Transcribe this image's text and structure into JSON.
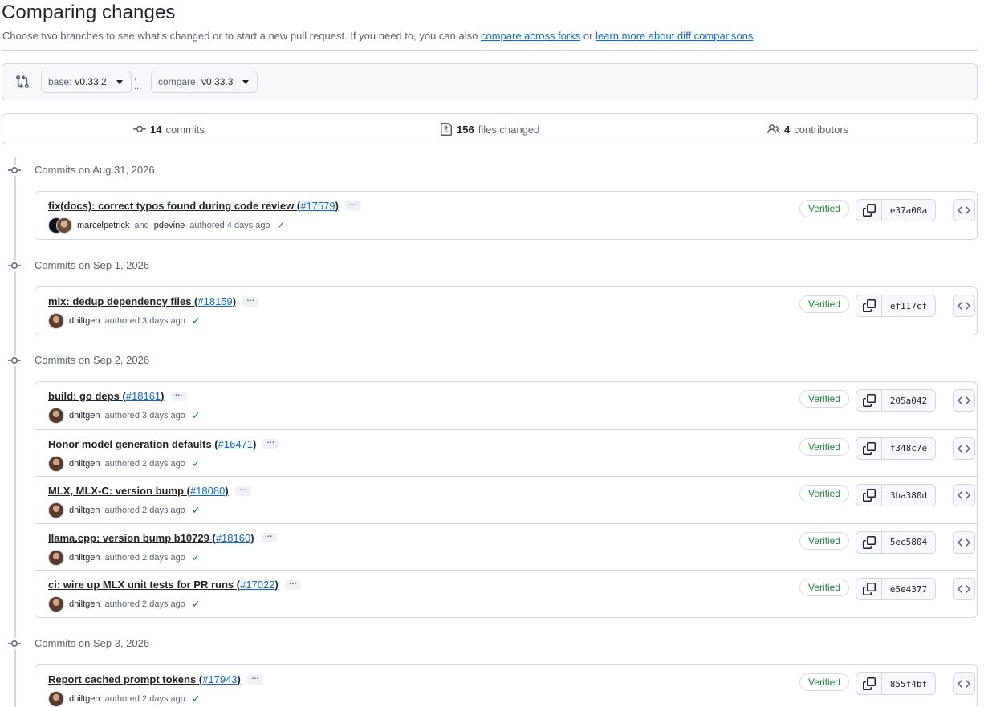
{
  "header": {
    "title": "Comparing changes",
    "subtitle_text": "Choose two branches to see what’s changed or to start a new pull request. If you need to, you can also",
    "link_forks": "compare across forks",
    "or_text": "or",
    "link_learn": "learn more about diff comparisons",
    "period": "."
  },
  "range": {
    "base_label": "base:",
    "base_value": "v0.33.2",
    "compare_label": "compare:",
    "compare_value": "v0.33.3",
    "arrow_dots": "..."
  },
  "summary": {
    "commits_count": "14",
    "commits_label": "commits",
    "files_count": "156",
    "files_label": "files changed",
    "contributors_count": "4",
    "contributors_label": "contributors"
  },
  "groups": [
    {
      "label": "Commits on Aug 31, 2026",
      "commits": [
        {
          "title": "fix(docs): correct typos found during code review",
          "pr": "#17579",
          "authors": [
            "marcelpetrick",
            "pdevine"
          ],
          "and_text": "and",
          "authored": "authored 4 days ago",
          "verified": "Verified",
          "sha": "e37a00a"
        }
      ]
    },
    {
      "label": "Commits on Sep 1, 2026",
      "commits": [
        {
          "title": "mlx: dedup dependency files",
          "pr": "#18159",
          "authors": [
            "dhiltgen"
          ],
          "authored": "authored 3 days ago",
          "verified": "Verified",
          "sha": "ef117cf"
        }
      ]
    },
    {
      "label": "Commits on Sep 2, 2026",
      "commits": [
        {
          "title": "build: go deps",
          "pr": "#18161",
          "authors": [
            "dhiltgen"
          ],
          "authored": "authored 3 days ago",
          "verified": "Verified",
          "sha": "205a042"
        },
        {
          "title": "Honor model generation defaults",
          "pr": "#16471",
          "authors": [
            "dhiltgen"
          ],
          "authored": "authored 2 days ago",
          "verified": "Verified",
          "sha": "f348c7e"
        },
        {
          "title": "MLX, MLX-C: version bump",
          "pr": "#18080",
          "authors": [
            "dhiltgen"
          ],
          "authored": "authored 2 days ago",
          "verified": "Verified",
          "sha": "3ba380d"
        },
        {
          "title": "llama.cpp: version bump b10729",
          "pr": "#18160",
          "authors": [
            "dhiltgen"
          ],
          "authored": "authored 2 days ago",
          "verified": "Verified",
          "sha": "5ec5804"
        },
        {
          "title": "ci: wire up MLX unit tests for PR runs",
          "pr": "#17022",
          "authors": [
            "dhiltgen"
          ],
          "authored": "authored 2 days ago",
          "verified": "Verified",
          "sha": "e5e4377"
        }
      ]
    },
    {
      "label": "Commits on Sep 3, 2026",
      "commits": [
        {
          "title": "Report cached prompt tokens",
          "pr": "#17943",
          "authors": [
            "dhiltgen"
          ],
          "authored": "authored 2 days ago",
          "verified": "Verified",
          "sha": "855f4bf"
        }
      ]
    }
  ],
  "colors": {
    "link": "#0969da",
    "verified": "#1a7f37",
    "border": "#d1d9e0",
    "muted": "#59636e"
  }
}
